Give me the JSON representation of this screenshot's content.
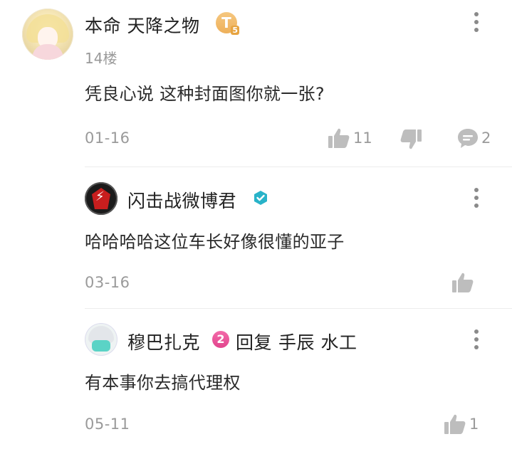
{
  "comments": [
    {
      "user": "本命 天降之物",
      "badge": "T",
      "badge_sub": "5",
      "floor": "14楼",
      "text": "凭良心说 这种封面图你就一张?",
      "date": "01-16",
      "likes": "11",
      "replies": "2"
    },
    {
      "user": "闪击战微博君",
      "text": "哈哈哈哈这位车长好像很懂的亚子",
      "date": "03-16"
    },
    {
      "user": "穆巴扎克",
      "level": "2",
      "reply_prefix": "回复",
      "reply_to": "手辰 水工",
      "text": "有本事你去搞代理权",
      "date": "05-11",
      "likes": "1"
    }
  ],
  "colors": {
    "text": "#222222",
    "meta": "#9a9a9a",
    "verified": "#29b3c9",
    "level": "#e2458d",
    "badge": "#eeb05a"
  },
  "icons": [
    "kebab-menu-icon",
    "thumb-up-icon",
    "thumb-down-icon",
    "comment-bubble-icon",
    "verified-icon"
  ]
}
